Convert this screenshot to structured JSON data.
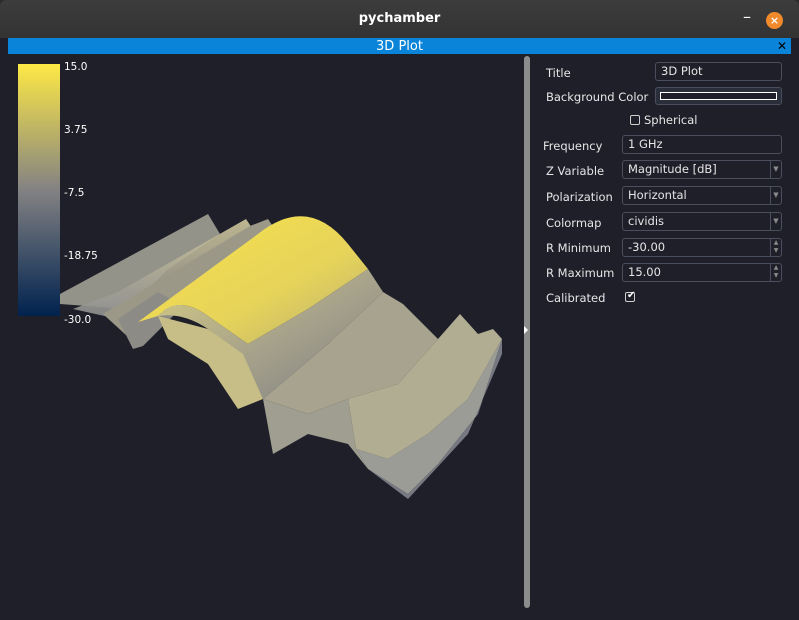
{
  "window": {
    "title": "pychamber",
    "minimize_label": "–",
    "close_label": "×"
  },
  "dock": {
    "title": "3D Plot",
    "close_label": "✕"
  },
  "colorbar": {
    "labels": [
      "15.0",
      "3.75",
      "-7.5",
      "-18.75",
      "-30.0"
    ],
    "colors": {
      "top": "#fde945",
      "mid": "#838283",
      "bottom": "#00224e"
    }
  },
  "settings": {
    "title_label": "Title",
    "title_value": "3D Plot",
    "bg_color_label": "Background Color",
    "spherical_label": "Spherical",
    "spherical_checked": false,
    "frequency_label": "Frequency",
    "frequency_value": "1 GHz",
    "z_variable_label": "Z Variable",
    "z_variable_value": "Magnitude [dB]",
    "polarization_label": "Polarization",
    "polarization_value": "Horizontal",
    "colormap_label": "Colormap",
    "colormap_value": "cividis",
    "r_min_label": "R Minimum",
    "r_min_value": "-30.00",
    "r_max_label": "R Maximum",
    "r_max_value": "15.00",
    "calibrated_label": "Calibrated",
    "calibrated_checked": true
  },
  "icons": {
    "splitter_arrow": "triangle-right-icon",
    "combo_arrow": "chevron-down-icon"
  },
  "colors": {
    "titlebar": "#363636",
    "dock_header": "#0a84d8",
    "background": "#1e1f29",
    "close_button": "#f08a2a"
  }
}
